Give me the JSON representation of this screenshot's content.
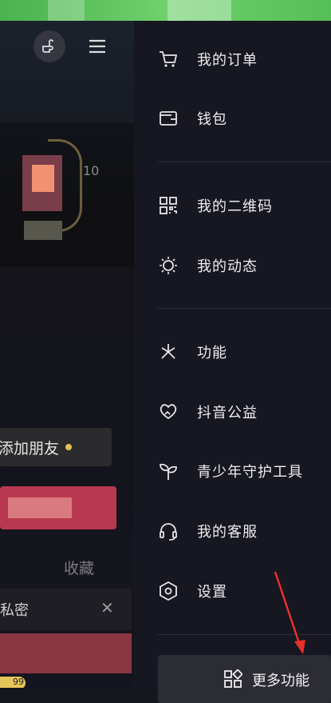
{
  "left_panel": {
    "number_text": "10",
    "add_friend": "添加朋友",
    "collect": "收藏",
    "private": "私密",
    "badge": "99"
  },
  "drawer": {
    "items": [
      {
        "label": "我的订单",
        "icon": "cart-icon"
      },
      {
        "label": "钱包",
        "icon": "wallet-icon"
      },
      {
        "label": "我的二维码",
        "icon": "qrcode-icon"
      },
      {
        "label": "我的动态",
        "icon": "activity-icon"
      },
      {
        "label": "功能",
        "icon": "functions-icon"
      },
      {
        "label": "抖音公益",
        "icon": "charity-icon"
      },
      {
        "label": "青少年守护工具",
        "icon": "sprout-icon"
      },
      {
        "label": "我的客服",
        "icon": "headset-icon"
      },
      {
        "label": "设置",
        "icon": "settings-icon"
      }
    ],
    "more_label": "更多功能"
  },
  "colors": {
    "drawer_bg": "#161720",
    "annotation_arrow": "#e8302a"
  }
}
